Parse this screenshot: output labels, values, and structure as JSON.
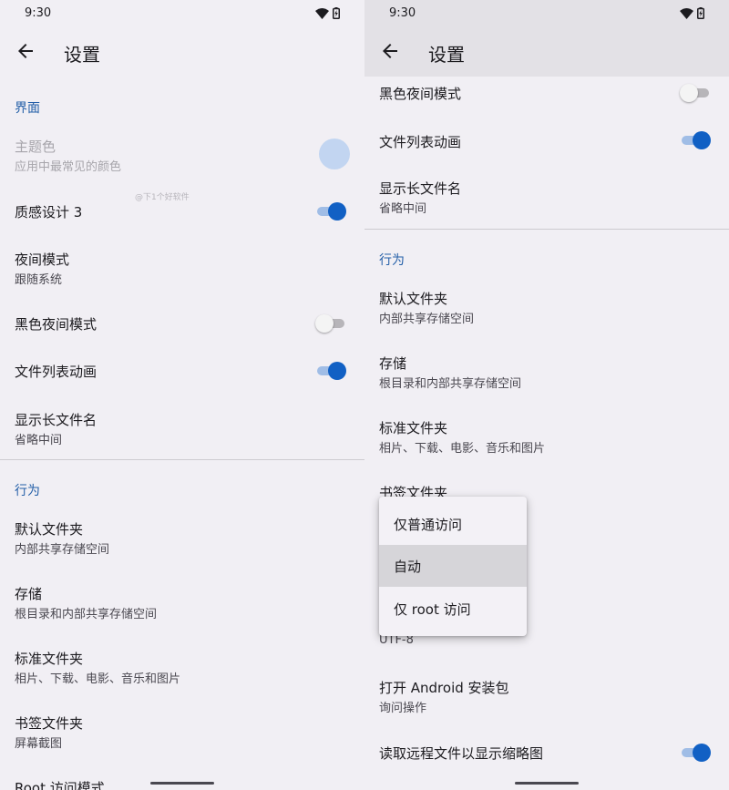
{
  "status": {
    "time": "9:30"
  },
  "appbar": {
    "title": "设置"
  },
  "left": {
    "section_ui": "界面",
    "theme_color": {
      "title": "主题色",
      "subtitle": "应用中最常见的颜色",
      "color": "#c2d5f1"
    },
    "watermark": "@下1个好软件",
    "material3": {
      "title": "质感设计 3",
      "on": true
    },
    "night_mode": {
      "title": "夜间模式",
      "subtitle": "跟随系统"
    },
    "black_night": {
      "title": "黑色夜间模式",
      "on": false
    },
    "list_anim": {
      "title": "文件列表动画",
      "on": true
    },
    "long_name": {
      "title": "显示长文件名",
      "subtitle": "省略中间"
    },
    "section_behavior": "行为",
    "default_folder": {
      "title": "默认文件夹",
      "subtitle": "内部共享存储空间"
    },
    "storage": {
      "title": "存储",
      "subtitle": "根目录和内部共享存储空间"
    },
    "std_folder": {
      "title": "标准文件夹",
      "subtitle": "相片、下载、电影、音乐和图片"
    },
    "bookmark": {
      "title": "书签文件夹",
      "subtitle": "屏幕截图"
    },
    "root_mode": {
      "title": "Root 访问模式"
    }
  },
  "right": {
    "black_night": {
      "title": "黑色夜间模式",
      "on": false
    },
    "list_anim": {
      "title": "文件列表动画",
      "on": true
    },
    "long_name": {
      "title": "显示长文件名",
      "subtitle": "省略中间"
    },
    "section_behavior": "行为",
    "default_folder": {
      "title": "默认文件夹",
      "subtitle": "内部共享存储空间"
    },
    "storage": {
      "title": "存储",
      "subtitle": "根目录和内部共享存储空间"
    },
    "std_folder": {
      "title": "标准文件夹",
      "subtitle": "相片、下载、电影、音乐和图片"
    },
    "bookmark": {
      "title": "书签文件夹"
    },
    "encoding_sub": "UTF-8",
    "open_apk": {
      "title": "打开 Android 安装包",
      "subtitle": "询问操作"
    },
    "thumbnails": {
      "title": "读取远程文件以显示缩略图",
      "on": true
    },
    "menu": {
      "options": [
        "仅普通访问",
        "自动",
        "仅 root 访问"
      ],
      "selected": "自动"
    }
  },
  "colors": {
    "accent": "#1160c4",
    "section": "#245fa8",
    "background": "#f1eff4"
  }
}
